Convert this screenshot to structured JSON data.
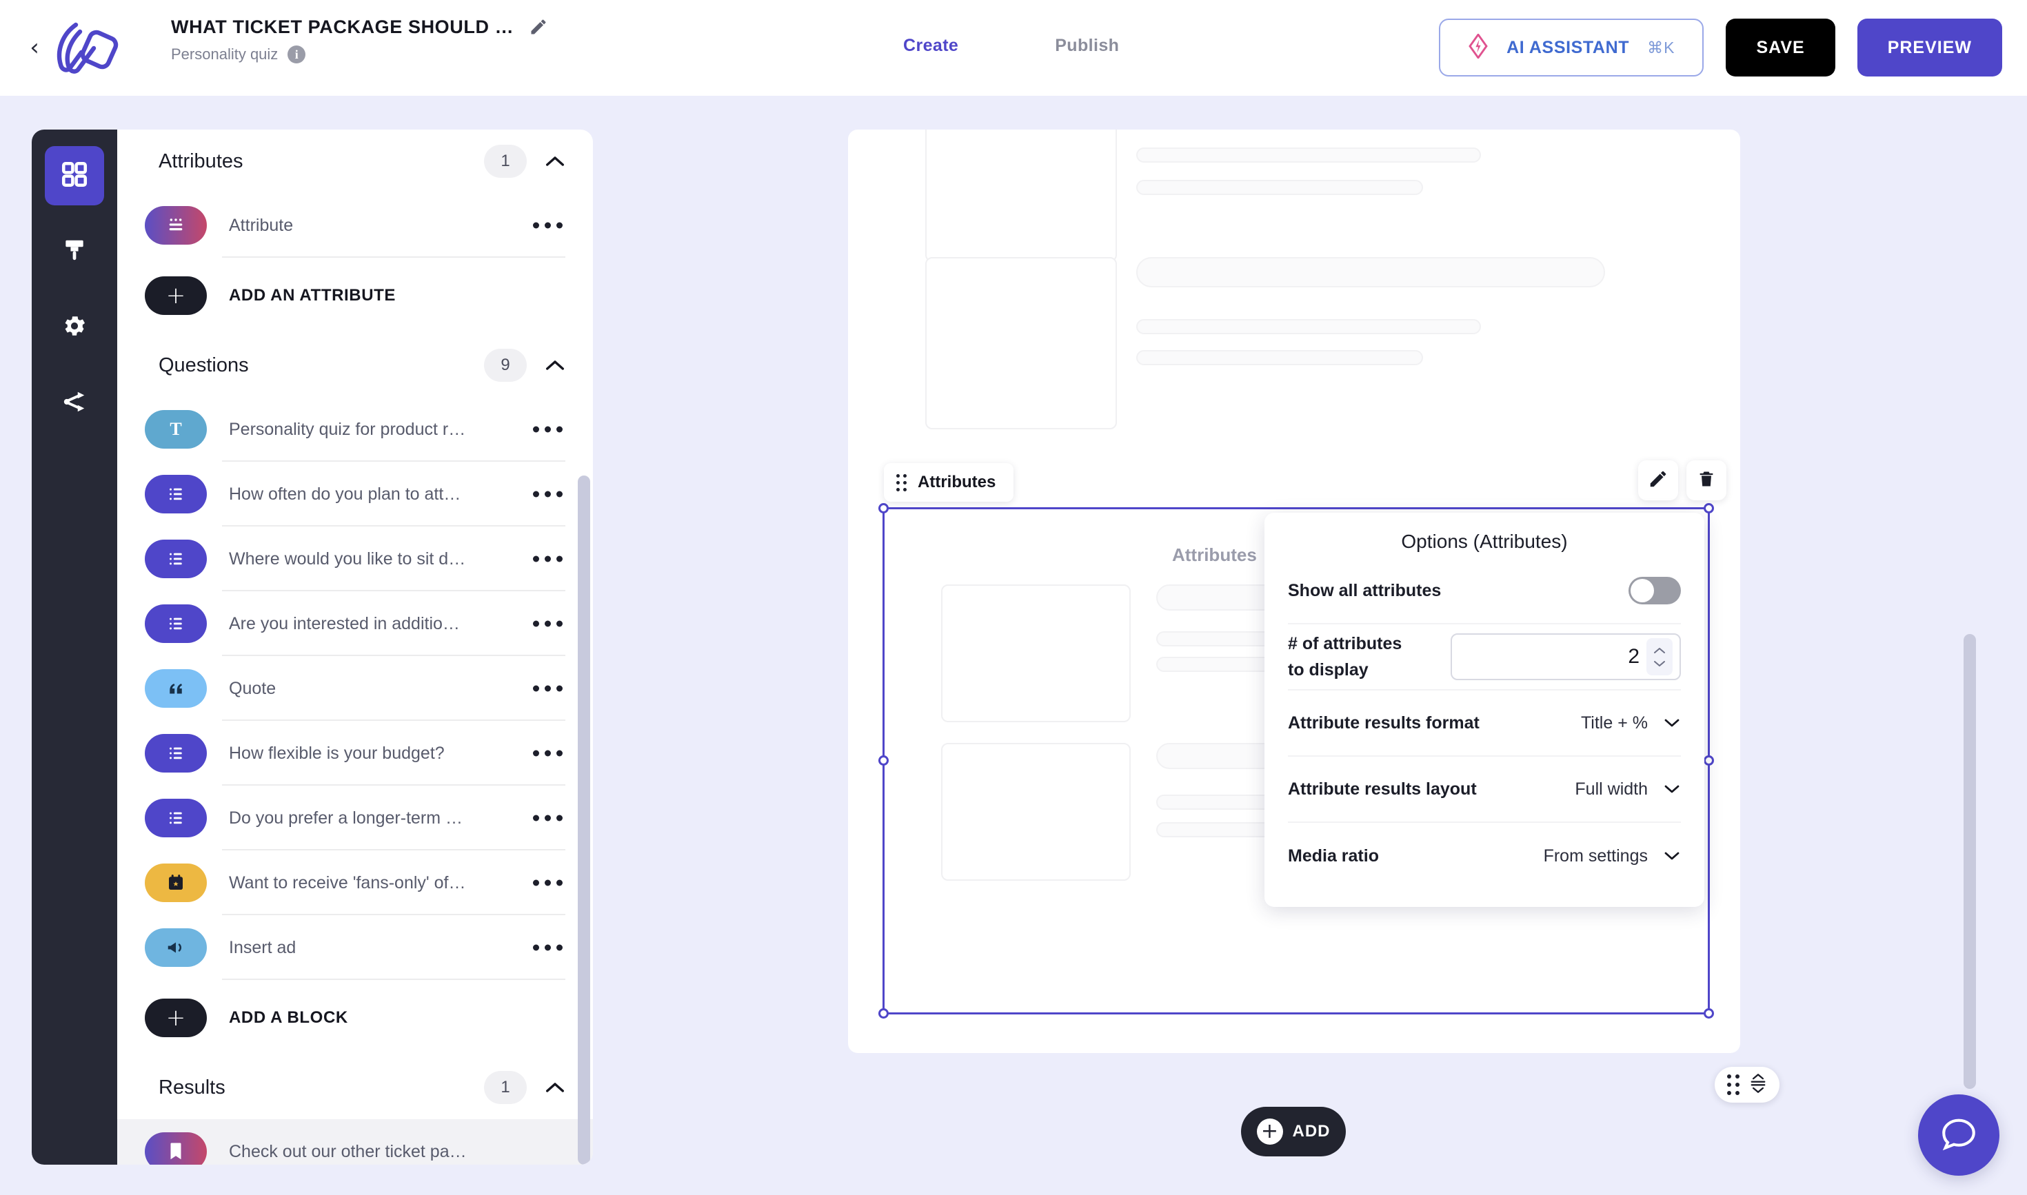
{
  "header": {
    "back_icon": "chevron-left-icon",
    "logo_icon": "brand-logo-icon",
    "doc_title": "WHAT TICKET PACKAGE SHOULD …",
    "edit_icon": "pencil-icon",
    "subtitle": "Personality quiz",
    "info_icon": "info-icon",
    "tabs": [
      {
        "label": "Create",
        "active": true
      },
      {
        "label": "Publish",
        "active": false
      }
    ],
    "ai_assistant": {
      "icon": "ai-spark-icon",
      "label": "AI ASSISTANT",
      "shortcut": "⌘K"
    },
    "save_label": "SAVE",
    "preview_label": "PREVIEW"
  },
  "rail": {
    "items": [
      {
        "icon": "grid-blocks-icon",
        "active": true
      },
      {
        "icon": "paint-brush-icon",
        "active": false
      },
      {
        "icon": "gear-icon",
        "active": false
      },
      {
        "icon": "share-nodes-icon",
        "active": false
      }
    ]
  },
  "panel": {
    "sections": [
      {
        "title": "Attributes",
        "count": "1",
        "collapse_icon": "chevron-up-icon",
        "rows": [
          {
            "label": "Attribute",
            "icon": "attribute-list-icon",
            "menu_icon": "more-options-icon"
          }
        ],
        "add": {
          "label": "ADD AN ATTRIBUTE",
          "icon": "plus-icon"
        }
      },
      {
        "title": "Questions",
        "count": "9",
        "collapse_icon": "chevron-up-icon",
        "rows": [
          {
            "label": "Personality quiz for product r…",
            "icon": "text-block-icon",
            "menu_icon": "more-options-icon"
          },
          {
            "label": "How often do you plan to att…",
            "icon": "question-list-icon",
            "menu_icon": "more-options-icon"
          },
          {
            "label": "Where would you like to sit d…",
            "icon": "question-list-icon",
            "menu_icon": "more-options-icon"
          },
          {
            "label": "Are you interested in additio…",
            "icon": "question-list-icon",
            "menu_icon": "more-options-icon"
          },
          {
            "label": "Quote",
            "icon": "quote-icon",
            "menu_icon": "more-options-icon"
          },
          {
            "label": "How flexible is your budget?",
            "icon": "question-list-icon",
            "menu_icon": "more-options-icon"
          },
          {
            "label": "Do you prefer a longer-term …",
            "icon": "question-list-icon",
            "menu_icon": "more-options-icon"
          },
          {
            "label": "Want to receive 'fans-only' of…",
            "icon": "calendar-icon",
            "menu_icon": "more-options-icon"
          },
          {
            "label": "Insert ad",
            "icon": "megaphone-icon",
            "menu_icon": "more-options-icon"
          }
        ],
        "add": {
          "label": "ADD A BLOCK",
          "icon": "plus-icon"
        }
      },
      {
        "title": "Results",
        "count": "1",
        "collapse_icon": "chevron-up-icon",
        "rows": [
          {
            "label": "Check out our other ticket pa…",
            "icon": "bookmark-icon",
            "menu_icon": "more-options-icon",
            "selected": true
          }
        ]
      }
    ]
  },
  "canvas": {
    "block_tag": {
      "label": "Attributes",
      "grip_icon": "drag-grip-icon"
    },
    "edit_icon": "pencil-icon",
    "delete_icon": "trash-icon",
    "attributes_placeholder": "Attributes",
    "add_button": {
      "label": "ADD",
      "icon": "plus-circle-icon"
    },
    "float_control": {
      "grip_icon": "drag-grip-icon",
      "resize_icon": "resize-vertical-icon"
    },
    "chat_icon": "chat-bubble-icon"
  },
  "options_panel": {
    "title": "Options (Attributes)",
    "rows": [
      {
        "label": "Show all attributes",
        "type": "toggle",
        "value": "off"
      },
      {
        "label": "# of attributes\nto display",
        "label_line1": "# of attributes",
        "label_line2": "to display",
        "type": "number",
        "value": "2",
        "stepper_icon": "stepper-arrows-icon"
      },
      {
        "label": "Attribute results format",
        "type": "select",
        "value": "Title + %",
        "chevron_icon": "chevron-down-icon"
      },
      {
        "label": "Attribute results layout",
        "type": "select",
        "value": "Full width",
        "chevron_icon": "chevron-down-icon"
      },
      {
        "label": "Media ratio",
        "type": "select",
        "value": "From settings",
        "chevron_icon": "chevron-down-icon"
      }
    ]
  },
  "colors": {
    "accent": "#4f46c9",
    "dark": "#272936",
    "page_bg": "#ecedfb",
    "muted_text": "#7c7f90"
  }
}
